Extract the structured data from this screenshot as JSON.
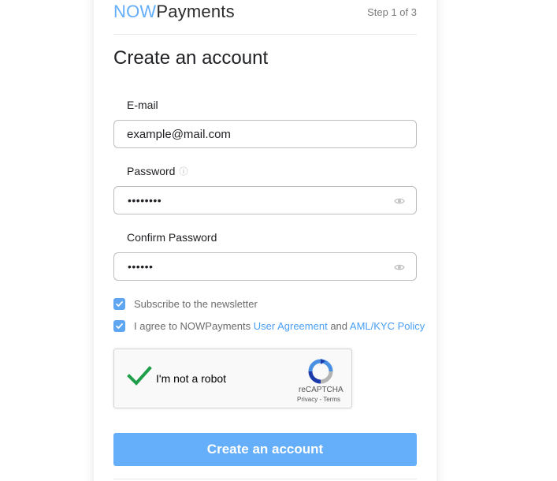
{
  "header": {
    "logo_now": "NOW",
    "logo_payments": "Payments",
    "step": "Step 1 of 3"
  },
  "form": {
    "title": "Create an account",
    "email": {
      "label": "E-mail",
      "value": "example@mail.com"
    },
    "password": {
      "label": "Password",
      "masked_value": "••••••••",
      "info_icon": "info-icon",
      "toggle_icon": "eye-icon"
    },
    "confirm_password": {
      "label": "Confirm Password",
      "masked_value": "••••••",
      "toggle_icon": "eye-icon"
    },
    "newsletter": {
      "checked": true,
      "text": "Subscribe to the newsletter"
    },
    "agreement": {
      "checked": true,
      "prefix": "I agree to NOWPayments",
      "link_user_agreement": "User Agreement",
      "conjunction": "and",
      "link_aml_kyc": "AML/KYC Policy"
    },
    "recaptcha": {
      "checked": true,
      "label": "I'm not a robot",
      "brand": "reCAPTCHA",
      "privacy": "Privacy",
      "separator": " - ",
      "terms": "Terms"
    },
    "submit_label": "Create an account"
  },
  "colors": {
    "accent": "#64aefa",
    "link": "#4a9ff5",
    "checkbox": "#5ea5f2",
    "captcha_check": "#1e9e48"
  }
}
